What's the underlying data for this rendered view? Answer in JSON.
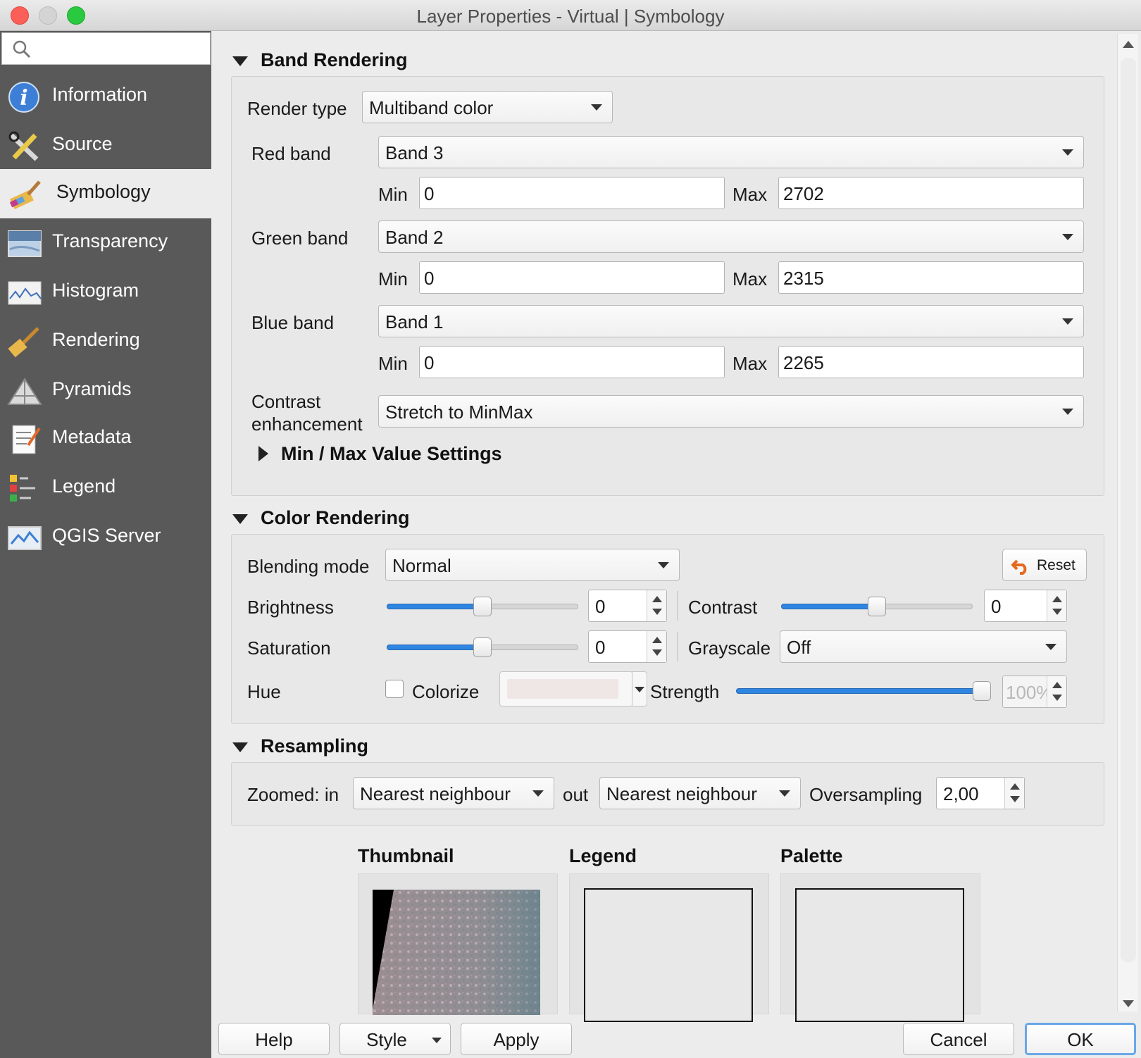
{
  "window": {
    "title": "Layer Properties - Virtual | Symbology"
  },
  "sidebar": {
    "search_placeholder": "",
    "items": [
      {
        "label": "Information",
        "icon": "info-icon"
      },
      {
        "label": "Source",
        "icon": "source-tools-icon"
      },
      {
        "label": "Symbology",
        "icon": "paintbrush-icon",
        "active": true
      },
      {
        "label": "Transparency",
        "icon": "transparency-icon"
      },
      {
        "label": "Histogram",
        "icon": "histogram-icon"
      },
      {
        "label": "Rendering",
        "icon": "rendering-brush-icon"
      },
      {
        "label": "Pyramids",
        "icon": "pyramids-icon"
      },
      {
        "label": "Metadata",
        "icon": "metadata-icon"
      },
      {
        "label": "Legend",
        "icon": "legend-icon"
      },
      {
        "label": "QGIS Server",
        "icon": "qgis-server-icon"
      }
    ]
  },
  "band_rendering": {
    "title": "Band Rendering",
    "render_type_label": "Render type",
    "render_type": "Multiband color",
    "red": {
      "label": "Red band",
      "band": "Band 3",
      "min_label": "Min",
      "min": "0",
      "max_label": "Max",
      "max": "2702"
    },
    "green": {
      "label": "Green band",
      "band": "Band 2",
      "min_label": "Min",
      "min": "0",
      "max_label": "Max",
      "max": "2315"
    },
    "blue": {
      "label": "Blue band",
      "band": "Band 1",
      "min_label": "Min",
      "min": "0",
      "max_label": "Max",
      "max": "2265"
    },
    "contrast_label_1": "Contrast",
    "contrast_label_2": "enhancement",
    "contrast_value": "Stretch to MinMax",
    "minmax_title": "Min / Max Value Settings"
  },
  "color_rendering": {
    "title": "Color Rendering",
    "blending_label": "Blending mode",
    "blending_value": "Normal",
    "reset_label": "Reset",
    "brightness_label": "Brightness",
    "brightness_value": "0",
    "brightness_level": 0.5,
    "contrast_label": "Contrast",
    "contrast_value": "0",
    "contrast_level": 0.5,
    "saturation_label": "Saturation",
    "saturation_value": "0",
    "saturation_level": 0.5,
    "grayscale_label": "Grayscale",
    "grayscale_value": "Off",
    "hue_label": "Hue",
    "colorize_label": "Colorize",
    "colorize_checked": false,
    "colorize_color": "#efe6e6",
    "strength_label": "Strength",
    "strength_value": "100%",
    "strength_level": 1.0
  },
  "resampling": {
    "title": "Resampling",
    "zoomed_in_label": "Zoomed: in",
    "zoomed_in_value": "Nearest neighbour",
    "out_label": "out",
    "zoomed_out_value": "Nearest neighbour",
    "oversampling_label": "Oversampling",
    "oversampling_value": "2,00"
  },
  "preview": {
    "thumbnail_label": "Thumbnail",
    "legend_label": "Legend",
    "palette_label": "Palette"
  },
  "buttons": {
    "help": "Help",
    "style": "Style",
    "apply": "Apply",
    "cancel": "Cancel",
    "ok": "OK"
  },
  "colors": {
    "accent": "#2f86e0",
    "sidebar_bg": "#595959",
    "close": "#fc5f57",
    "minimize": "#d0d0d0",
    "zoom": "#29c940"
  }
}
